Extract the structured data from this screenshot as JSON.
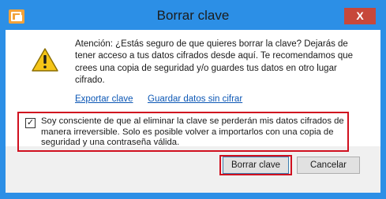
{
  "window": {
    "title": "Borrar clave",
    "close_glyph": "X"
  },
  "dialog": {
    "message": "Atención: ¿Estás seguro de que quieres borrar la clave? Dejarás de tener acceso a tus datos cifrados desde aquí. Te recomendamos que crees una copia de seguridad y/o guardes tus datos en otro lugar cifrado.",
    "links": {
      "export": "Exportar clave",
      "save": "Guardar datos sin cifrar"
    },
    "checkbox": {
      "checked": true,
      "glyph": "✓",
      "label": "Soy consciente de que al eliminar la clave se perderán mis datos cifrados de manera irreversible. Solo es posible volver a importarlos con una copia de seguridad y una contraseña válida."
    },
    "buttons": {
      "confirm": "Borrar clave",
      "cancel": "Cancelar"
    }
  },
  "colors": {
    "title_bar": "#2c8fe6",
    "close_button": "#c7483a",
    "highlight": "#d0101f",
    "link": "#0c57b5",
    "warning": "#f5c518"
  },
  "icons": {
    "app": "app-window-icon",
    "warning": "warning-triangle-icon"
  }
}
